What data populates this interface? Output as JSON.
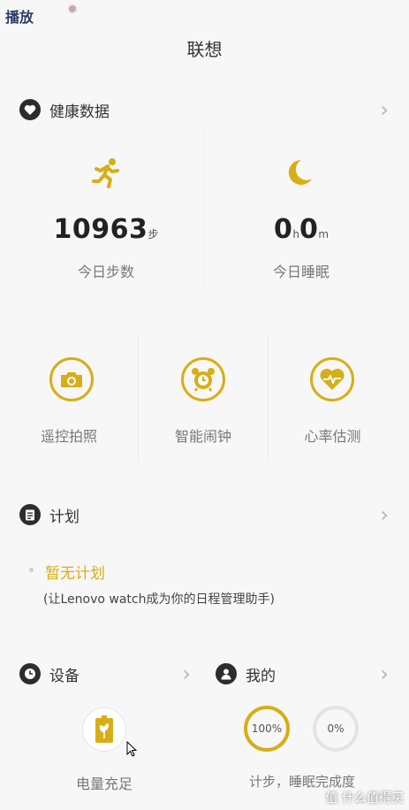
{
  "overlay": {
    "badge": "播放"
  },
  "header": {
    "title": "联想"
  },
  "health": {
    "title": "健康数据",
    "steps": {
      "value": "10963",
      "unit": "步",
      "label": "今日步数"
    },
    "sleep": {
      "hours": "0",
      "hours_unit": "h",
      "minutes": "0",
      "minutes_unit": "m",
      "label": "今日睡眠"
    }
  },
  "functions": [
    {
      "label": "遥控拍照"
    },
    {
      "label": "智能闹钟"
    },
    {
      "label": "心率估测"
    }
  ],
  "plan": {
    "title": "计划",
    "empty_title": "暂无计划",
    "empty_desc": "(让Lenovo watch成为你的日程管理助手)"
  },
  "device": {
    "title": "设备",
    "battery_label": "电量充足"
  },
  "mine": {
    "title": "我的",
    "step_progress": "100%",
    "sleep_progress": "0%",
    "label": "计步，睡眠完成度"
  },
  "watermark": {
    "text": "值 什么值得买"
  },
  "colors": {
    "accent": "#d6ae17",
    "dark": "#2d2d2d"
  }
}
